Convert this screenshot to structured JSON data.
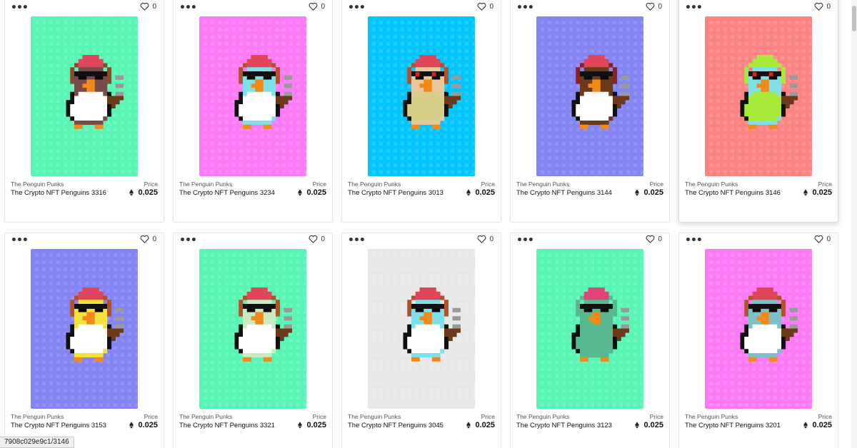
{
  "colors": {
    "mint": "#5af5b5",
    "pink": "#fa7bf5",
    "cyan": "#04c4fc",
    "periwinkle": "#8484f2",
    "salmon": "#fa8484",
    "lightgray": "#e8e8e8"
  },
  "price_label": "Price",
  "currency_icon": "ethereum-icon",
  "cards": [
    {
      "collection": "The Penguin Punks",
      "title": "The Crypto NFT Penguins 3316",
      "price": "0.025",
      "likes": "0",
      "bg": "mint",
      "body": "#7a4a4a",
      "belly": "#ffffff",
      "hat": "#e0455a",
      "head": "#7a4a4a",
      "headphones": "#8a4a2a",
      "eyes": "#111111"
    },
    {
      "collection": "The Penguin Punks",
      "title": "The Crypto NFT Penguins 3234",
      "price": "0.025",
      "likes": "0",
      "bg": "pink",
      "body": "#7ee0e8",
      "belly": "#ffffff",
      "hat": "#e0455a",
      "head": "#7ee0e8",
      "headphones": "#b0532a",
      "eyes": "#111111"
    },
    {
      "collection": "The Penguin Punks",
      "title": "The Crypto NFT Penguins 3013",
      "price": "0.025",
      "likes": "0",
      "bg": "cyan",
      "body": "#e8c89a",
      "belly": "#d6cf8a",
      "hat": "#e0455a",
      "head": "#e8c89a",
      "headphones": "#b0532a",
      "eyes": "#e02020"
    },
    {
      "collection": "The Penguin Punks",
      "title": "The Crypto NFT Penguins 3144",
      "price": "0.025",
      "likes": "0",
      "bg": "periwinkle",
      "body": "#6a3a1a",
      "belly": "#ffffff",
      "hat": "#e0455a",
      "head": "#6a3a1a",
      "headphones": "#8a2222",
      "eyes": "#111111"
    },
    {
      "collection": "The Penguin Punks",
      "title": "The Crypto NFT Penguins 3146",
      "price": "0.025",
      "likes": "0",
      "bg": "salmon",
      "body": "#7ee0e8",
      "belly": "#a8ea3a",
      "hat": "#a8ea3a",
      "head": "#7ee0e8",
      "headphones": "#a8ea3a",
      "eyes": "#e02020"
    },
    {
      "collection": "The Penguin Punks",
      "title": "The Crypto NFT Penguins 3153",
      "price": "0.025",
      "likes": "0",
      "bg": "periwinkle",
      "body": "#f2e23a",
      "belly": "#ffffff",
      "hat": "#e0455a",
      "head": "#f2e23a",
      "headphones": "#b0532a",
      "eyes": "#111111"
    },
    {
      "collection": "The Penguin Punks",
      "title": "The Crypto NFT Penguins 3321",
      "price": "0.025",
      "likes": "0",
      "bg": "mint",
      "body": "#c8ecc0",
      "belly": "#ffffff",
      "hat": "#e0455a",
      "head": "#c8ecc0",
      "headphones": "#b0532a",
      "eyes": "#111111"
    },
    {
      "collection": "The Penguin Punks",
      "title": "The Crypto NFT Penguins 3045",
      "price": "0.025",
      "likes": "0",
      "bg": "lightgray",
      "body": "#7ee0e8",
      "belly": "#ffffff",
      "hat": "#e0455a",
      "head": "#7ee0e8",
      "headphones": "#b0532a",
      "eyes": "#111111"
    },
    {
      "collection": "The Penguin Punks",
      "title": "The Crypto NFT Penguins 3123",
      "price": "0.025",
      "likes": "0",
      "bg": "mint",
      "body": "#5ab890",
      "belly": "#5ab890",
      "hat": "#e0457a",
      "head": "#5ab890",
      "headphones": "#5ab890",
      "eyes": "#111111"
    },
    {
      "collection": "The Penguin Punks",
      "title": "The Crypto NFT Penguins 3201",
      "price": "0.025",
      "likes": "0",
      "bg": "pink",
      "body": "#7ec0c8",
      "belly": "#ffffff",
      "hat": "#e0455a",
      "head": "#7ec0c8",
      "headphones": "#b0532a",
      "eyes": "#111111"
    }
  ],
  "status_url": "7908c029e9c1/3146"
}
